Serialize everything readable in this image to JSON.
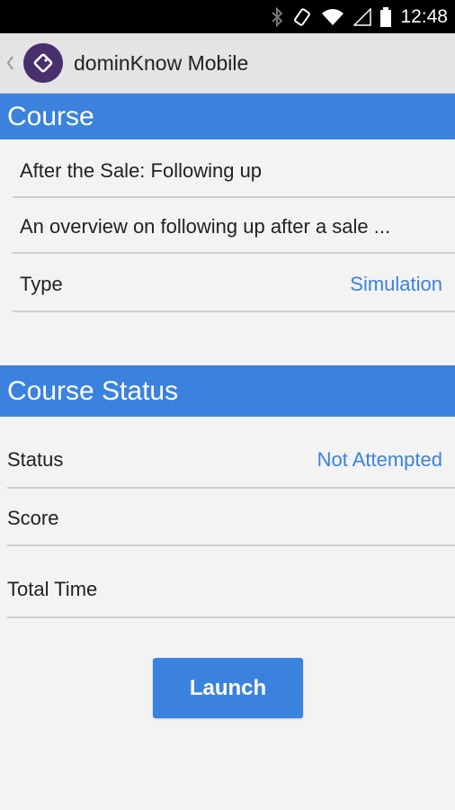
{
  "status_bar": {
    "time": "12:48",
    "icons": [
      "bluetooth-icon",
      "rotate-icon",
      "wifi-icon",
      "signal-icon",
      "battery-icon"
    ]
  },
  "action_bar": {
    "title": "dominKnow Mobile",
    "logo_color": "#4a2f6e"
  },
  "course": {
    "header": "Course",
    "title": "After the Sale: Following up",
    "description": "An overview on following up after a sale ...",
    "type_label": "Type",
    "type_value": "Simulation"
  },
  "course_status": {
    "header": "Course Status",
    "status_label": "Status",
    "status_value": "Not Attempted",
    "score_label": "Score",
    "score_value": "",
    "total_time_label": "Total Time",
    "total_time_value": ""
  },
  "actions": {
    "launch_label": "Launch"
  },
  "colors": {
    "accent": "#3b82de",
    "background": "#f3f3f3"
  }
}
